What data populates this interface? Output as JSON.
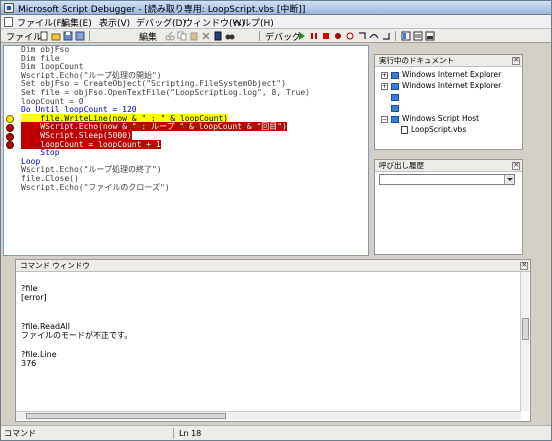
{
  "window": {
    "title": "Microsoft Script Debugger - [読み取り専用: LoopScript.vbs [中断]]"
  },
  "menu": {
    "items": [
      "ファイル(F)",
      "編集(E)",
      "表示(V)",
      "デバッグ(D)",
      "ウィンドウ(W)",
      "ヘルプ(H)"
    ]
  },
  "toolbar": {
    "file_label": "ファイル",
    "edit_label": "編集",
    "debug_label": "デバッグ"
  },
  "editor": {
    "lines": [
      "Dim objFso",
      "Dim file",
      "Dim loopCount",
      "Wscript.Echo(\"ループ処理の開始\")",
      "Set objFso = CreateObject(\"Scripting.FileSystemObject\")",
      "Set file = objFso.OpenTextFile(\"LoopScriptLog.log\", 8, True)",
      "loopCount = 0",
      "Do Until loopCount = 120",
      "    file.WriteLine(now & \" : \" & loopCount)",
      "    WScript.Echo(now & \" : ループ \" & loopCount & \"回目\")",
      "    WScript.Sleep(5000)",
      "    loopCount = loopCount + 1",
      "    Stop",
      "Loop",
      "Wscript.Echo(\"ループ処理の終了\")",
      "file.Close()",
      "Wscript.Echo(\"ファイルのクローズ\")"
    ]
  },
  "running_docs": {
    "title": "実行中のドキュメント",
    "items": [
      "Windows Internet Explorer",
      "Windows Internet Explorer",
      "",
      "",
      "Windows Script Host",
      "LoopScript.vbs"
    ]
  },
  "callstack": {
    "title": "呼び出し履歴"
  },
  "command": {
    "title": "コマンド ウィンドウ",
    "lines": [
      "?file",
      "[error]",
      "",
      "",
      "?file.ReadAll",
      "ファイルのモードが不正です。",
      "",
      "?file.Line",
      "376"
    ]
  },
  "status": {
    "left": "コマンド",
    "position": "Ln 18"
  }
}
